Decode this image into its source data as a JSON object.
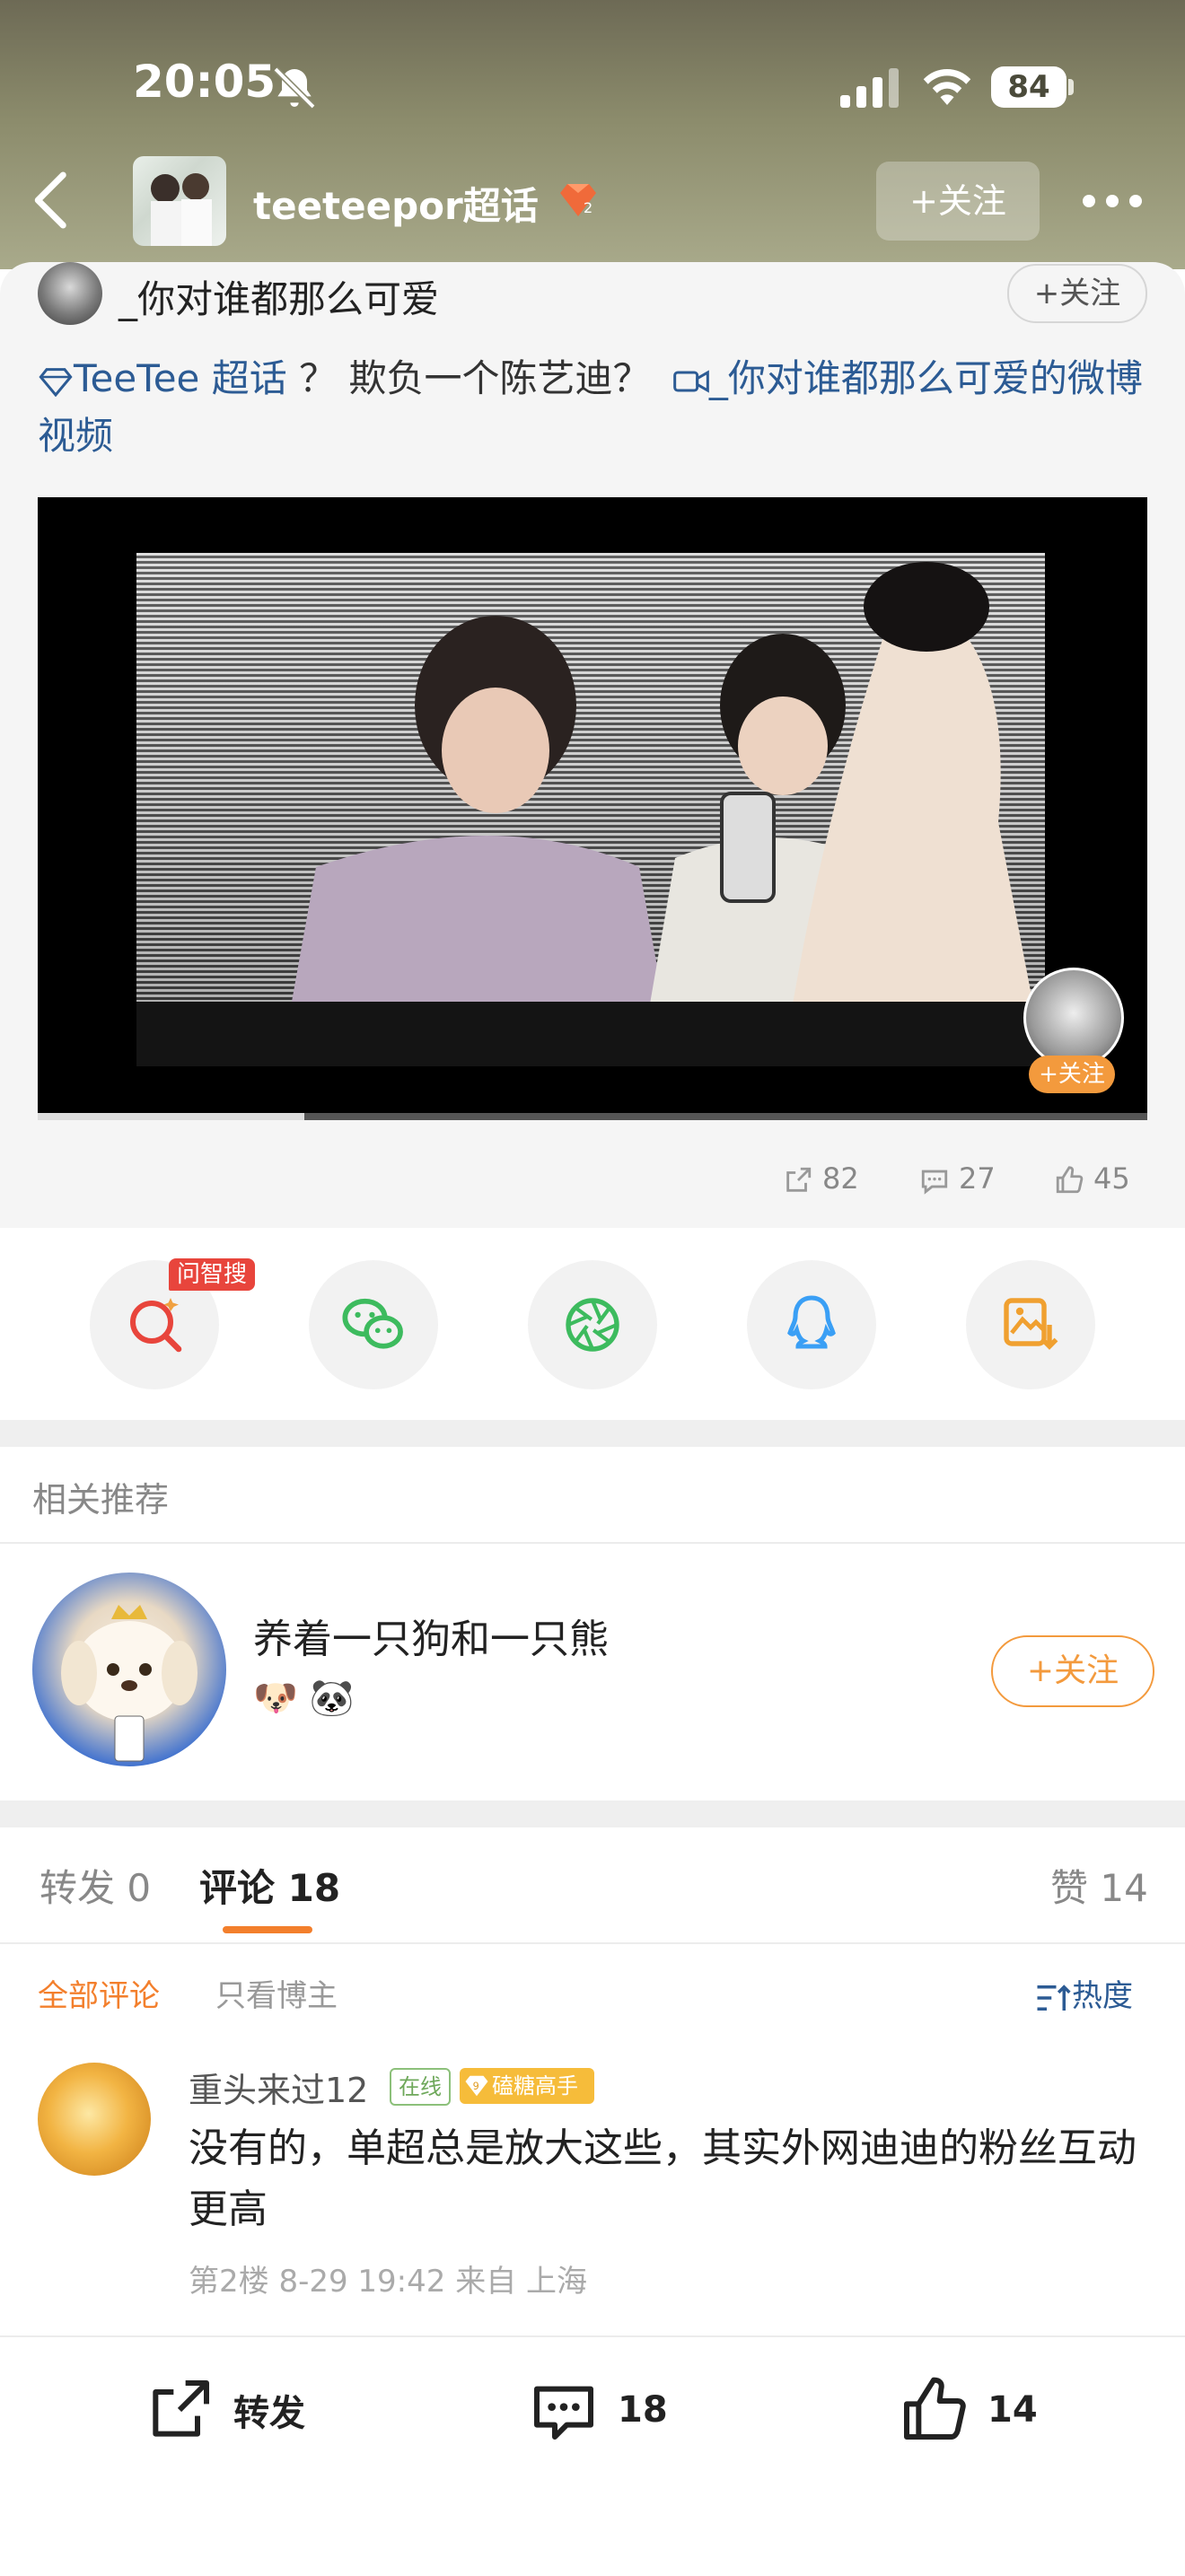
{
  "status_bar": {
    "time": "20:05",
    "battery": "84"
  },
  "header": {
    "supertopic_name": "teeteepor超话",
    "follow_label": "+关注"
  },
  "post": {
    "author_name": "_你对谁都那么可爱",
    "author_follow_label": "+关注",
    "topic_link": "TeeTee 超话",
    "text": "？ 欺负一个陈艺迪？",
    "video_link": "_你对谁都那么可爱的微博视频",
    "video_follow_label": "+关注",
    "progress": 0.24,
    "stats": {
      "reposts": "82",
      "comments": "27",
      "likes": "45"
    }
  },
  "share": {
    "ai_badge": "问智搜"
  },
  "recommend": {
    "header": "相关推荐",
    "name": "养着一只狗和一只熊",
    "emojis": "🐶 🐼",
    "follow_label": "+关注"
  },
  "tabs": {
    "repost": "转发 0",
    "comment": "评论 18",
    "like": "赞 14"
  },
  "filters": {
    "all": "全部评论",
    "author_only": "只看博主",
    "sort": "热度"
  },
  "comment": {
    "user": "重头来过12",
    "online": "在线",
    "badge": "磕糖高手",
    "badge_level": "9",
    "text": "没有的，单超总是放大这些，其实外网迪迪的粉丝互动更高",
    "meta": "第2楼 8-29 19:42 来自 上海"
  },
  "bottom_bar": {
    "repost": "转发",
    "comment": "18",
    "like": "14"
  },
  "colors": {
    "accent": "#f37f2c",
    "link": "#2c5b94",
    "follow_orange": "#f39a3d"
  }
}
